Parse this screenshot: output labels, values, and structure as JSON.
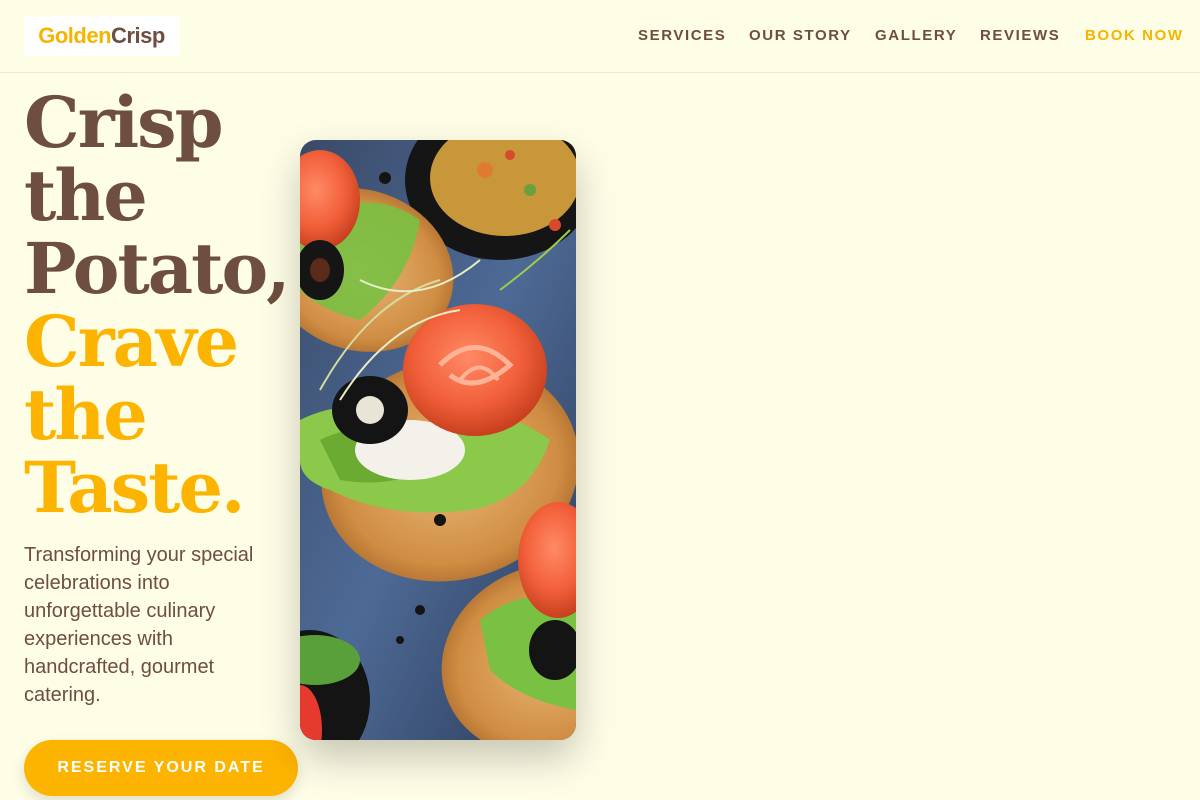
{
  "brand": {
    "part1": "Golden",
    "part2": "Crisp"
  },
  "nav": {
    "items": [
      "SERVICES",
      "OUR STORY",
      "GALLERY",
      "REVIEWS"
    ],
    "cta": "BOOK NOW"
  },
  "hero": {
    "headline_lines": [
      "Crisp",
      "the",
      "Potato,"
    ],
    "accent_lines": [
      "Crave",
      "the",
      "Taste."
    ],
    "subtitle": "Transforming your special celebrations into unforgettable culinary experiences with handcrafted, gourmet catering.",
    "button": "RESERVE YOUR DATE"
  },
  "image": {
    "subject": "smoked salmon canapés on toasted bread with lettuce, olives and sprouts on a slate board"
  },
  "colors": {
    "background": "#fefde6",
    "brown": "#6e4e3e",
    "gold": "#fdb400",
    "header_border": "#ecebd2"
  }
}
